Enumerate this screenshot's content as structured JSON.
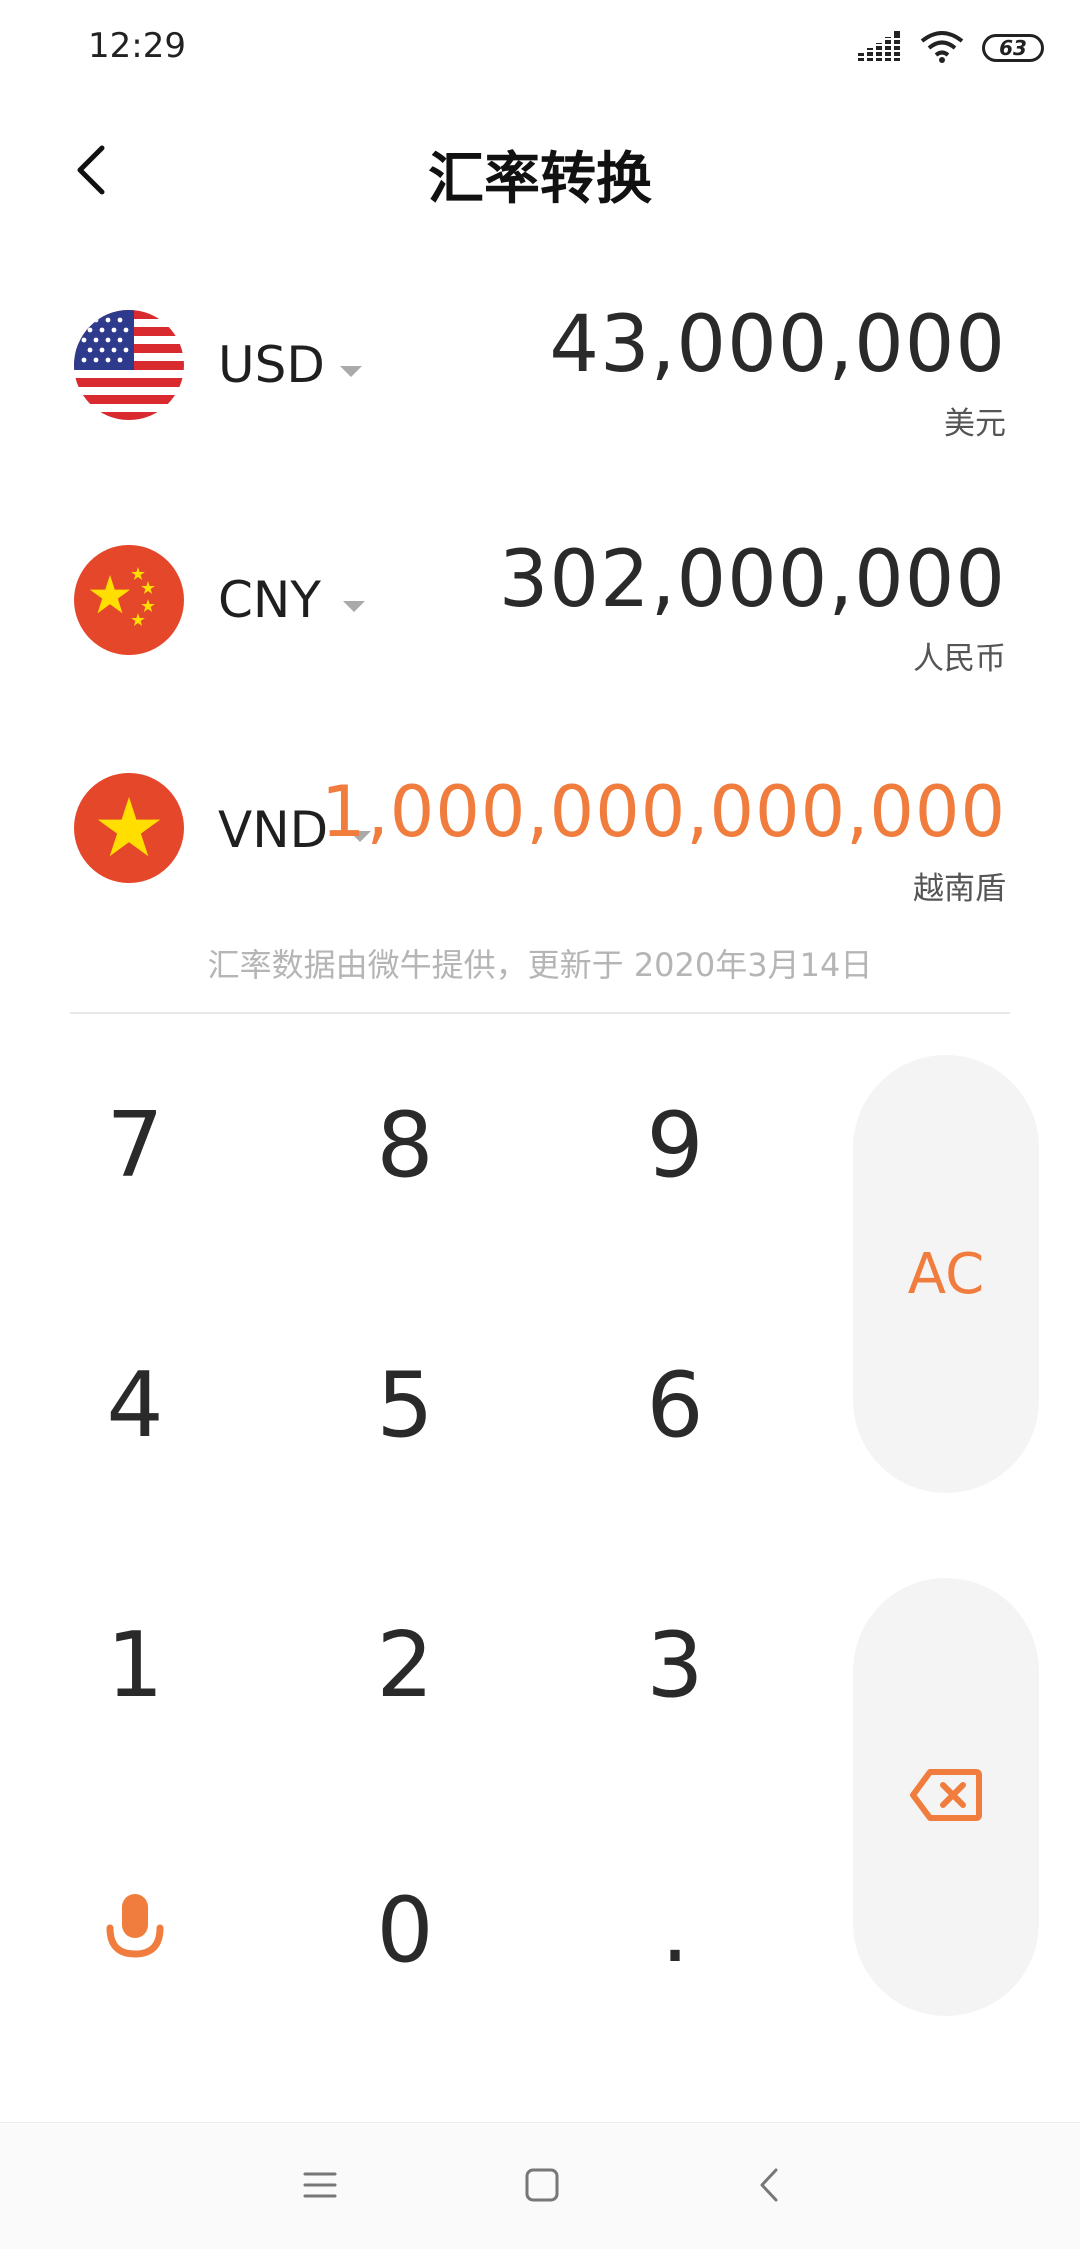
{
  "status_bar": {
    "time": "12:29",
    "battery": "63"
  },
  "header": {
    "title": "汇率转换"
  },
  "currencies": [
    {
      "code": "USD",
      "amount": "43,000,000",
      "name": "美元"
    },
    {
      "code": "CNY",
      "amount": "302,000,000",
      "name": "人民币"
    },
    {
      "code": "VND",
      "amount": "1,000,000,000,000",
      "name": "越南盾"
    }
  ],
  "footnote": "汇率数据由微牛提供，更新于 2020年3月14日",
  "keypad": {
    "keys": [
      "7",
      "8",
      "9",
      "4",
      "5",
      "6",
      "1",
      "2",
      "3",
      "0",
      "."
    ],
    "ac_label": "AC"
  },
  "colors": {
    "accent": "#f07c3d",
    "pill_bg": "#f4f4f4"
  },
  "icons": {
    "back": "chevron-left-icon",
    "mic": "microphone-icon",
    "backspace": "backspace-icon",
    "nav": [
      "menu-icon",
      "home-square-icon",
      "back-chevron-icon"
    ]
  }
}
